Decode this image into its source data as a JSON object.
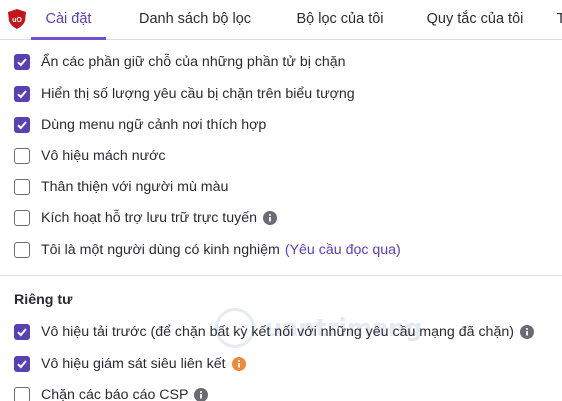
{
  "tabs": [
    {
      "label": "Cài đặt",
      "active": true
    },
    {
      "label": "Danh sách bộ lọc",
      "active": false
    },
    {
      "label": "Bộ lọc của tôi",
      "active": false
    },
    {
      "label": "Quy tắc của tôi",
      "active": false
    },
    {
      "label": "T",
      "active": false
    }
  ],
  "appearance": {
    "items": [
      {
        "label": "Ẩn các phần giữ chỗ của những phần tử bị chặn",
        "checked": true
      },
      {
        "label": "Hiển thị số lượng yêu cầu bị chặn trên biểu tượng",
        "checked": true
      },
      {
        "label": "Dùng menu ngữ cảnh nơi thích hợp",
        "checked": true
      },
      {
        "label": "Vô hiệu mách nước",
        "checked": false
      },
      {
        "label": "Thân thiện với người mù màu",
        "checked": false
      },
      {
        "label": "Kích hoạt hỗ trợ lưu trữ trực tuyến",
        "checked": false,
        "info_icon": "info-circle-icon"
      },
      {
        "label": "Tôi là một người dùng có kinh nghiệm",
        "checked": false,
        "link": "(Yêu cầu đọc qua)"
      }
    ]
  },
  "privacy": {
    "heading": "Riêng tư",
    "items": [
      {
        "label": "Vô hiệu tải trước (để chặn bất kỳ kết nối với những yêu cầu mạng đã chặn)",
        "checked": true,
        "info_icon": "info-circle-icon"
      },
      {
        "label": "Vô hiệu giám sát siêu liên kết",
        "checked": true,
        "info_icon": "info-circle-icon",
        "info_color": "#ef8a3a"
      },
      {
        "label": "Chặn các báo cáo CSP",
        "checked": false,
        "info_icon": "info-circle-icon"
      }
    ]
  },
  "watermark": {
    "text": "uantrimang"
  },
  "colors": {
    "accent": "#5940b3",
    "tab_active": "#5b3ebf",
    "logo": "#c0161c",
    "info": "#6b6b73",
    "info_warning": "#ef8a3a"
  }
}
